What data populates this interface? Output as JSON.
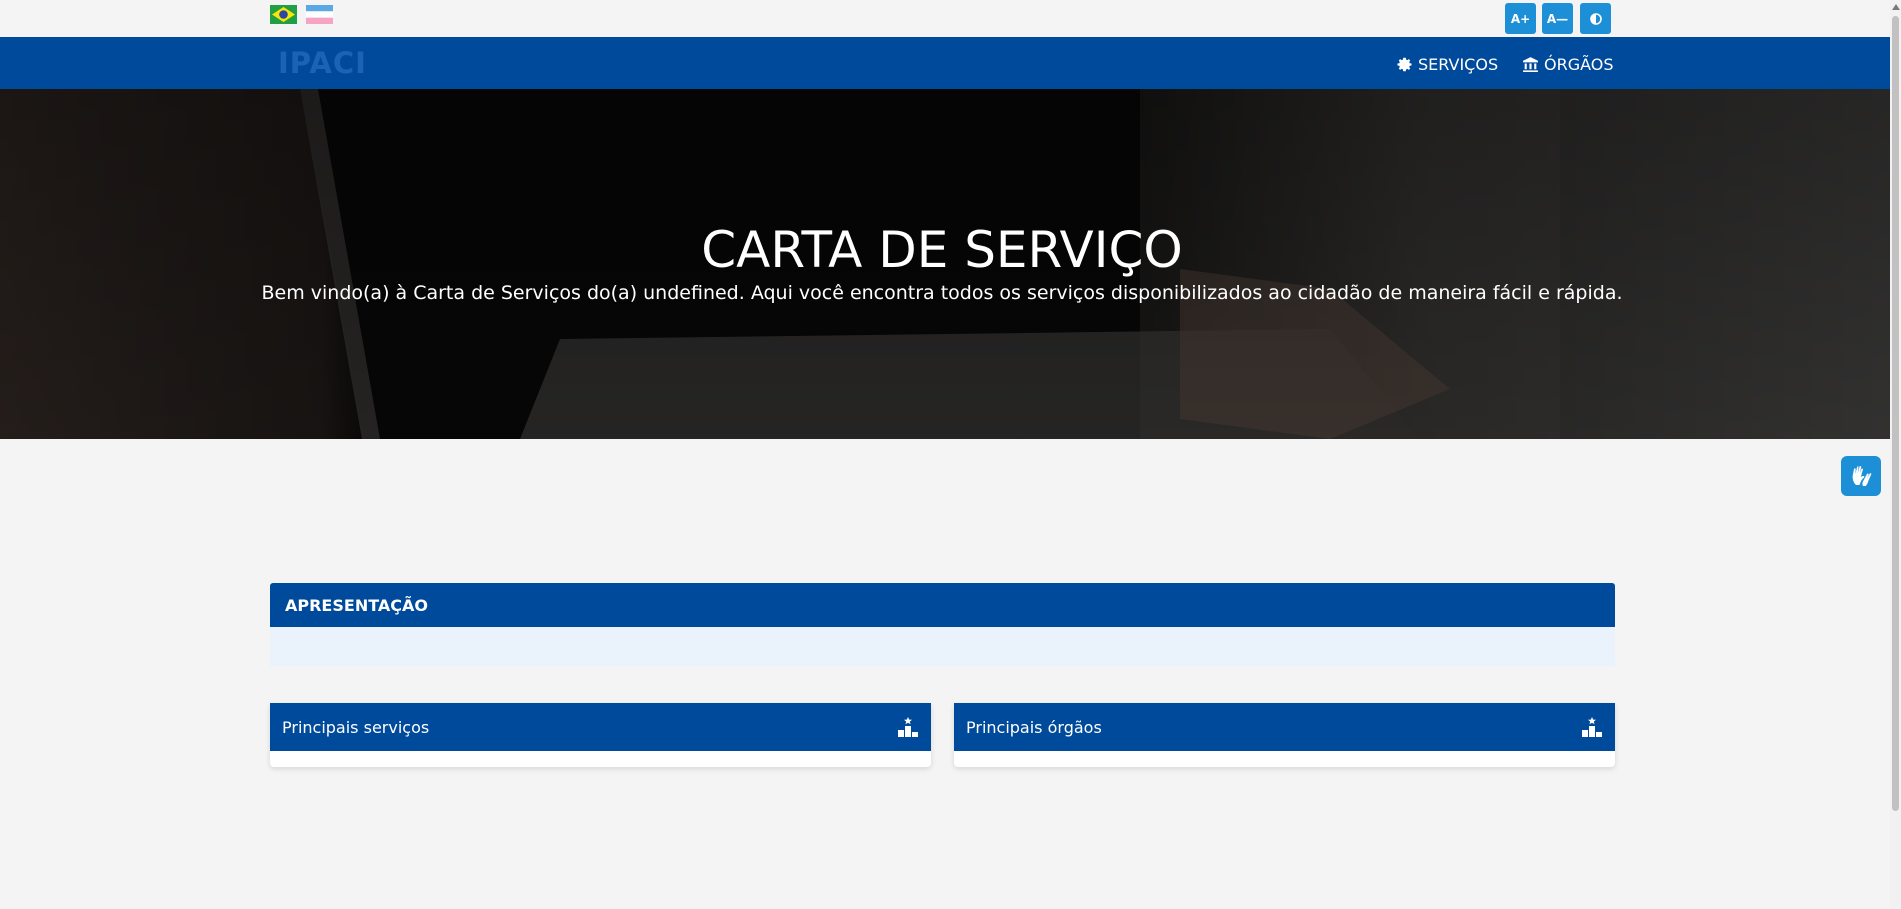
{
  "accessibility": {
    "increase_font_label": "A+",
    "decrease_font_label": "A—",
    "contrast_icon": "contrast-icon"
  },
  "language_flags": [
    "brazil-flag-icon",
    "espirito-santo-flag-icon"
  ],
  "header": {
    "logo_text": "IPACI",
    "nav": [
      {
        "label": "SERVIÇOS",
        "icon": "gear-icon"
      },
      {
        "label": "ÓRGÃOS",
        "icon": "building-columns-icon"
      }
    ]
  },
  "hero": {
    "title": "CARTA DE SERVIÇO",
    "subtitle": "Bem vindo(a) à Carta de Serviços do(a) undefined. Aqui você encontra todos os serviços disponibilizados ao cidadão de maneira fácil e rápida."
  },
  "apresentacao": {
    "title": "APRESENTAÇÃO"
  },
  "cards": [
    {
      "title": "Principais serviços",
      "icon": "podium-icon"
    },
    {
      "title": "Principais órgãos",
      "icon": "podium-icon"
    }
  ],
  "vlibras": {
    "icon": "sign-language-hands-icon"
  },
  "colors": {
    "primary": "#004a9c",
    "accent": "#1d8fd6",
    "background": "#f4f4f4",
    "apresentacao_body": "#eaf2fb"
  }
}
